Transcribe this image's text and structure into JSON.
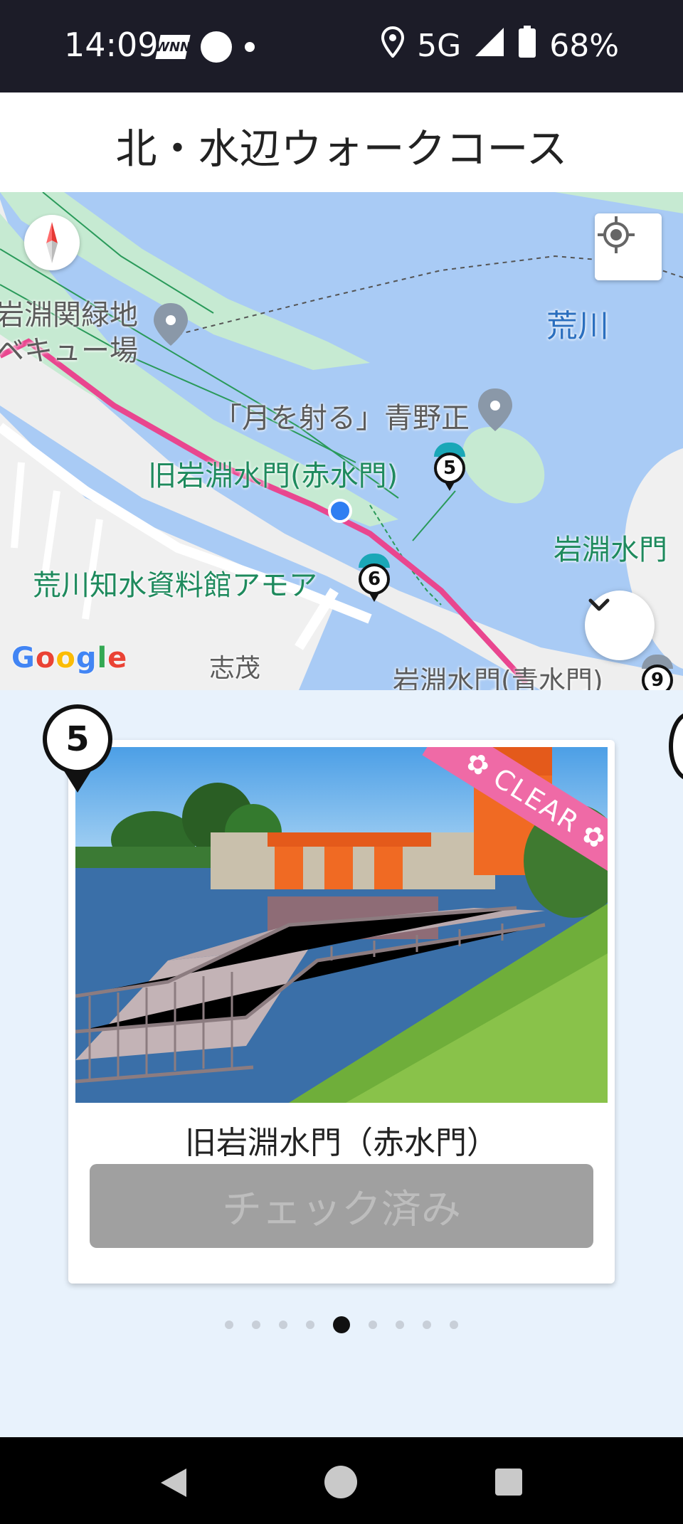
{
  "status_bar": {
    "time": "14:09",
    "network": "5G",
    "battery": "68%",
    "icons": [
      "wnn-icon",
      "app-face-icon",
      "dot-icon",
      "location-icon",
      "signal-icon",
      "battery-icon"
    ]
  },
  "header": {
    "title": "北・水辺ウォークコース"
  },
  "map": {
    "labels": {
      "park": "岩淵関緑地\nバーベキュー場",
      "park_line1": "岩淵関緑地",
      "park_line2": "ベキュー場",
      "river": "荒川",
      "monument": "「月を射る」青野正",
      "spot5": "旧岩淵水門(赤水門)",
      "gate": "岩淵水門",
      "museum": "荒川知水資料館アモア",
      "street": "志茂",
      "spot9": "岩淵水門(青水門)"
    },
    "markers": [
      "5",
      "6",
      "9"
    ],
    "google": "Google",
    "colors": {
      "route": "#e9468f",
      "water": "#a9cbf5",
      "park": "#c6ead2",
      "land": "#f1f1f1"
    }
  },
  "card": {
    "number": "5",
    "ribbon": "CLEAR",
    "name": "旧岩淵水門（赤水門）",
    "button": "チェック済み"
  },
  "pager": {
    "total": 9,
    "active_index": 4
  },
  "nav": {
    "icons": [
      "back-icon",
      "home-icon",
      "recents-icon"
    ]
  }
}
